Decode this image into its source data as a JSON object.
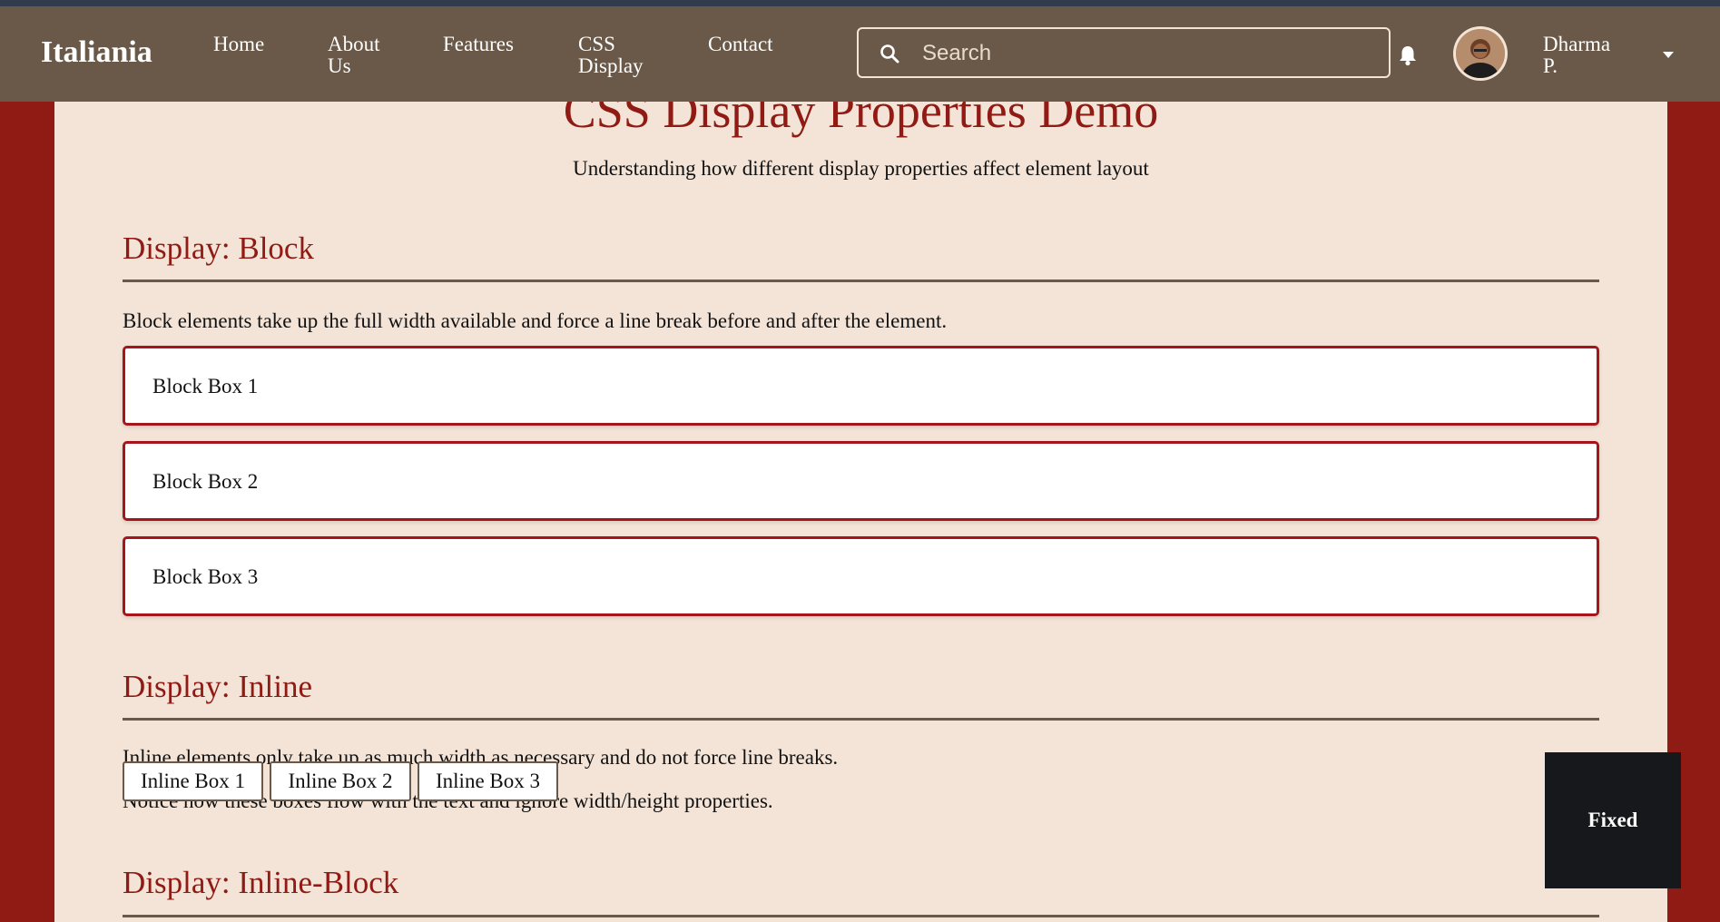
{
  "navbar": {
    "logo": "Italiania",
    "links": [
      "Home",
      "About",
      "Us",
      "Features",
      "CSS",
      "Display",
      "Contact"
    ],
    "search_placeholder": "Search",
    "user_name_line1": "Dharma",
    "user_name_line2": "P."
  },
  "main": {
    "title": "CSS Display Properties Demo",
    "subtitle": "Understanding how different display properties affect element layout",
    "block_section": {
      "heading": "Display: Block",
      "description": "Block elements take up the full width available and force a line break before and after the element.",
      "boxes": [
        "Block Box 1",
        "Block Box 2",
        "Block Box 3"
      ]
    },
    "inline_section": {
      "heading": "Display: Inline",
      "line1": "Inline elements only take up as much width as necessary and do not force line breaks.",
      "boxes": [
        "Inline Box 1",
        "Inline Box 2",
        "Inline Box 3"
      ],
      "line2": "Notice how these boxes flow with the text and ignore width/height properties."
    },
    "inline_block_section": {
      "heading": "Display: Inline-Block"
    }
  },
  "fixed_box": {
    "label": "Fixed"
  },
  "colors": {
    "navbar_bg": "#6a5948",
    "page_bg": "#8f1b14",
    "content_bg": "#f4e4d7",
    "accent_red": "#8f1b14",
    "block_border": "#a6141c",
    "fixed_bg": "#17181b"
  }
}
